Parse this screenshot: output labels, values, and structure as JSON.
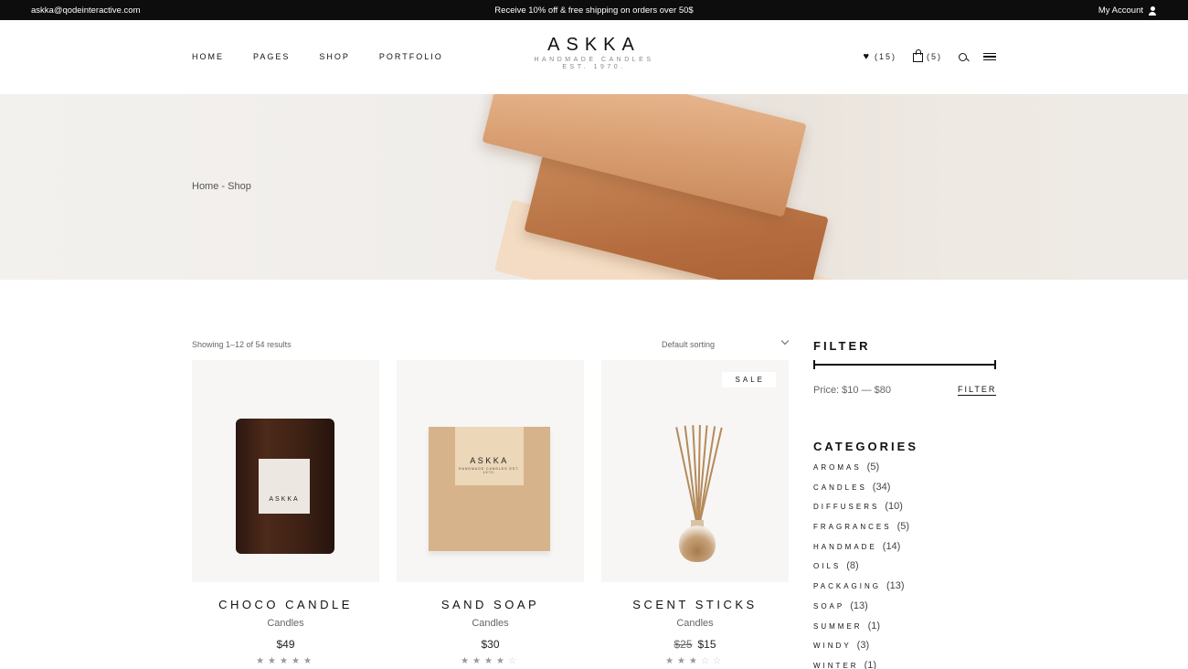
{
  "topbar": {
    "email": "askka@qodeinteractive.com",
    "promo": "Receive 10% off & free shipping on orders over 50$",
    "account": "My Account"
  },
  "nav": [
    "HOME",
    "PAGES",
    "SHOP",
    "PORTFOLIO"
  ],
  "logo": {
    "name": "ASKKA",
    "tagline": "HANDMADE CANDLES",
    "est": "EST. 1970."
  },
  "header_icons": {
    "wishlist_count": "(15)",
    "cart_count": "(5)"
  },
  "breadcrumb": "Home - Shop",
  "listing": {
    "result_count": "Showing 1–12 of 54 results",
    "sorting": "Default sorting"
  },
  "products": [
    {
      "title": "CHOCO CANDLE",
      "category": "Candles",
      "price": "$49",
      "old_price": "",
      "rating": 5,
      "label": "ASKKA"
    },
    {
      "title": "SAND SOAP",
      "category": "Candles",
      "price": "$30",
      "old_price": "",
      "rating": 4,
      "label": "ASKKA",
      "label_sub": "HANDMADE CANDLES EST. 1970."
    },
    {
      "title": "SCENT STICKS",
      "category": "Candles",
      "price": "$15",
      "old_price": "$25",
      "rating": 3,
      "badge": "SALE"
    }
  ],
  "filter": {
    "title": "FILTER",
    "price_label": "Price: $10 — $80",
    "button": "FILTER"
  },
  "categories": {
    "title": "CATEGORIES",
    "items": [
      {
        "name": "AROMAS",
        "count": "(5)"
      },
      {
        "name": "CANDLES",
        "count": "(34)"
      },
      {
        "name": "DIFFUSERS",
        "count": "(10)"
      },
      {
        "name": "FRAGRANCES",
        "count": "(5)"
      },
      {
        "name": "HANDMADE",
        "count": "(14)"
      },
      {
        "name": "OILS",
        "count": "(8)"
      },
      {
        "name": "PACKAGING",
        "count": "(13)"
      },
      {
        "name": "SOAP",
        "count": "(13)"
      },
      {
        "name": "SUMMER",
        "count": "(1)"
      },
      {
        "name": "WINDY",
        "count": "(3)"
      },
      {
        "name": "WINTER",
        "count": "(1)"
      }
    ]
  }
}
